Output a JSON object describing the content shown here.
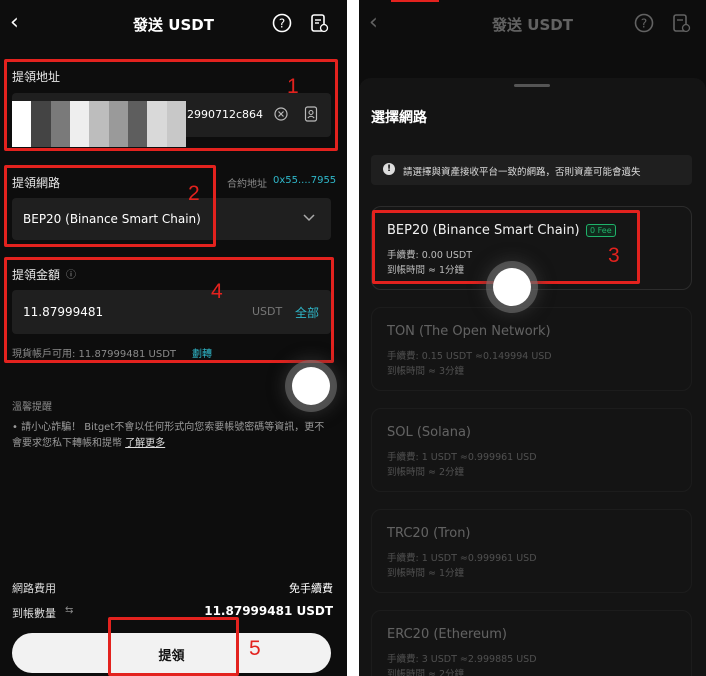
{
  "left": {
    "header": {
      "back": "‹",
      "title": "發送 USDT"
    },
    "address": {
      "label": "提領地址",
      "value_suffix": "2990712c864"
    },
    "network": {
      "label": "提領網路",
      "contract_label": "合約地址",
      "contract_value": "0x55....7955",
      "selected": "BEP20 (Binance Smart Chain)"
    },
    "amount": {
      "label": "提領金額",
      "info": "ⓘ",
      "value": "11.87999481",
      "unit": "USDT",
      "all_label": "全部",
      "available": "現貨帳戶可用: 11.87999481 USDT",
      "transfer_label": "劃轉"
    },
    "tips": {
      "title": "溫馨提醒",
      "text": "• 請小心詐騙！ Bitget不會以任何形式向您索要帳號密碼等資訊，更不會要求您私下轉帳和提幣",
      "link": "了解更多"
    },
    "fees": {
      "network_fee_label": "網路費用",
      "network_fee_value": "免手續費",
      "receive_label": "到帳數量",
      "receive_icon": "⇆",
      "receive_value": "11.87999481 USDT"
    },
    "submit_label": "提領",
    "annotations": [
      "1",
      "2",
      "4",
      "5"
    ]
  },
  "right": {
    "header": {
      "back": "‹",
      "title": "發送 USDT"
    },
    "sheet_title": "選擇網路",
    "warning": "請選擇與資產接收平台一致的網路，否則資產可能會遺失",
    "networks": [
      {
        "name": "BEP20 (Binance Smart Chain)",
        "badge": "0 Fee",
        "fee": "手續費: 0.00 USDT",
        "time": "到帳時間 ≈ 1分鐘"
      },
      {
        "name": "TON (The Open Network)",
        "fee": "手續費: 0.15 USDT ≈0.149994 USD",
        "time": "到帳時間 ≈ 3分鐘"
      },
      {
        "name": "SOL (Solana)",
        "fee": "手續費: 1 USDT ≈0.999961 USD",
        "time": "到帳時間 ≈ 2分鐘"
      },
      {
        "name": "TRC20 (Tron)",
        "fee": "手續費: 1 USDT ≈0.999961 USD",
        "time": "到帳時間 ≈ 1分鐘"
      },
      {
        "name": "ERC20 (Ethereum)",
        "fee": "手續費: 3 USDT ≈2.999885 USD",
        "time": "到帳時間 ≈ 2分鐘"
      }
    ],
    "annotations": [
      "3"
    ]
  },
  "colors": {
    "annotation": "#e3221e",
    "accent": "#2fb7c9",
    "fee_badge": "#1fb36a"
  }
}
